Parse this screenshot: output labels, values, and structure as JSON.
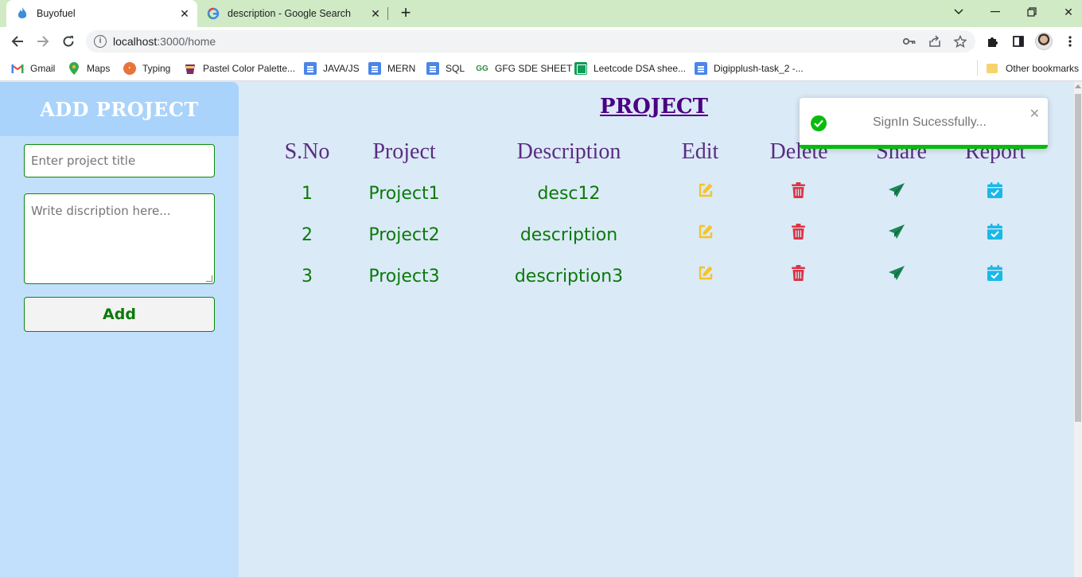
{
  "browser": {
    "tabs": [
      {
        "title": "Buyofuel",
        "active": true
      },
      {
        "title": "description - Google Search",
        "active": false
      }
    ],
    "url_host": "localhost",
    "url_path": ":3000/home",
    "bookmarks": [
      {
        "label": "Gmail",
        "icon": "gmail-icon"
      },
      {
        "label": "Maps",
        "icon": "maps-pin-icon"
      },
      {
        "label": "Typing",
        "icon": "typing-icon"
      },
      {
        "label": "Pastel Color Palette...",
        "icon": "cup-icon"
      },
      {
        "label": "JAVA/JS",
        "icon": "doc-icon"
      },
      {
        "label": "MERN",
        "icon": "doc-icon"
      },
      {
        "label": "SQL",
        "icon": "doc-icon"
      },
      {
        "label": "GFG SDE SHEET",
        "icon": "gfg-icon"
      },
      {
        "label": "Leetcode DSA shee...",
        "icon": "sheet-icon"
      },
      {
        "label": "Digipplush-task_2 -...",
        "icon": "doc-icon"
      }
    ],
    "other_bookmarks": "Other bookmarks"
  },
  "sidebar": {
    "heading": "ADD PROJECT",
    "title_placeholder": "Enter project title",
    "description_placeholder": "Write discription here...",
    "add_label": "Add"
  },
  "main": {
    "title": "PROJECT",
    "columns": [
      "S.No",
      "Project",
      "Description",
      "Edit",
      "Delete",
      "Share",
      "Report"
    ],
    "rows": [
      {
        "sno": "1",
        "project": "Project1",
        "description": "desc12"
      },
      {
        "sno": "2",
        "project": "Project2",
        "description": "description"
      },
      {
        "sno": "3",
        "project": "Project3",
        "description": "description3"
      }
    ],
    "icon_colors": {
      "edit": "#f7c325",
      "delete": "#dc3545",
      "share": "#198754",
      "report": "#1ab8e8"
    }
  },
  "toast": {
    "message": "SignIn Sucessfully...",
    "progress_fraction": 1.0,
    "color": "#07bc0c"
  }
}
